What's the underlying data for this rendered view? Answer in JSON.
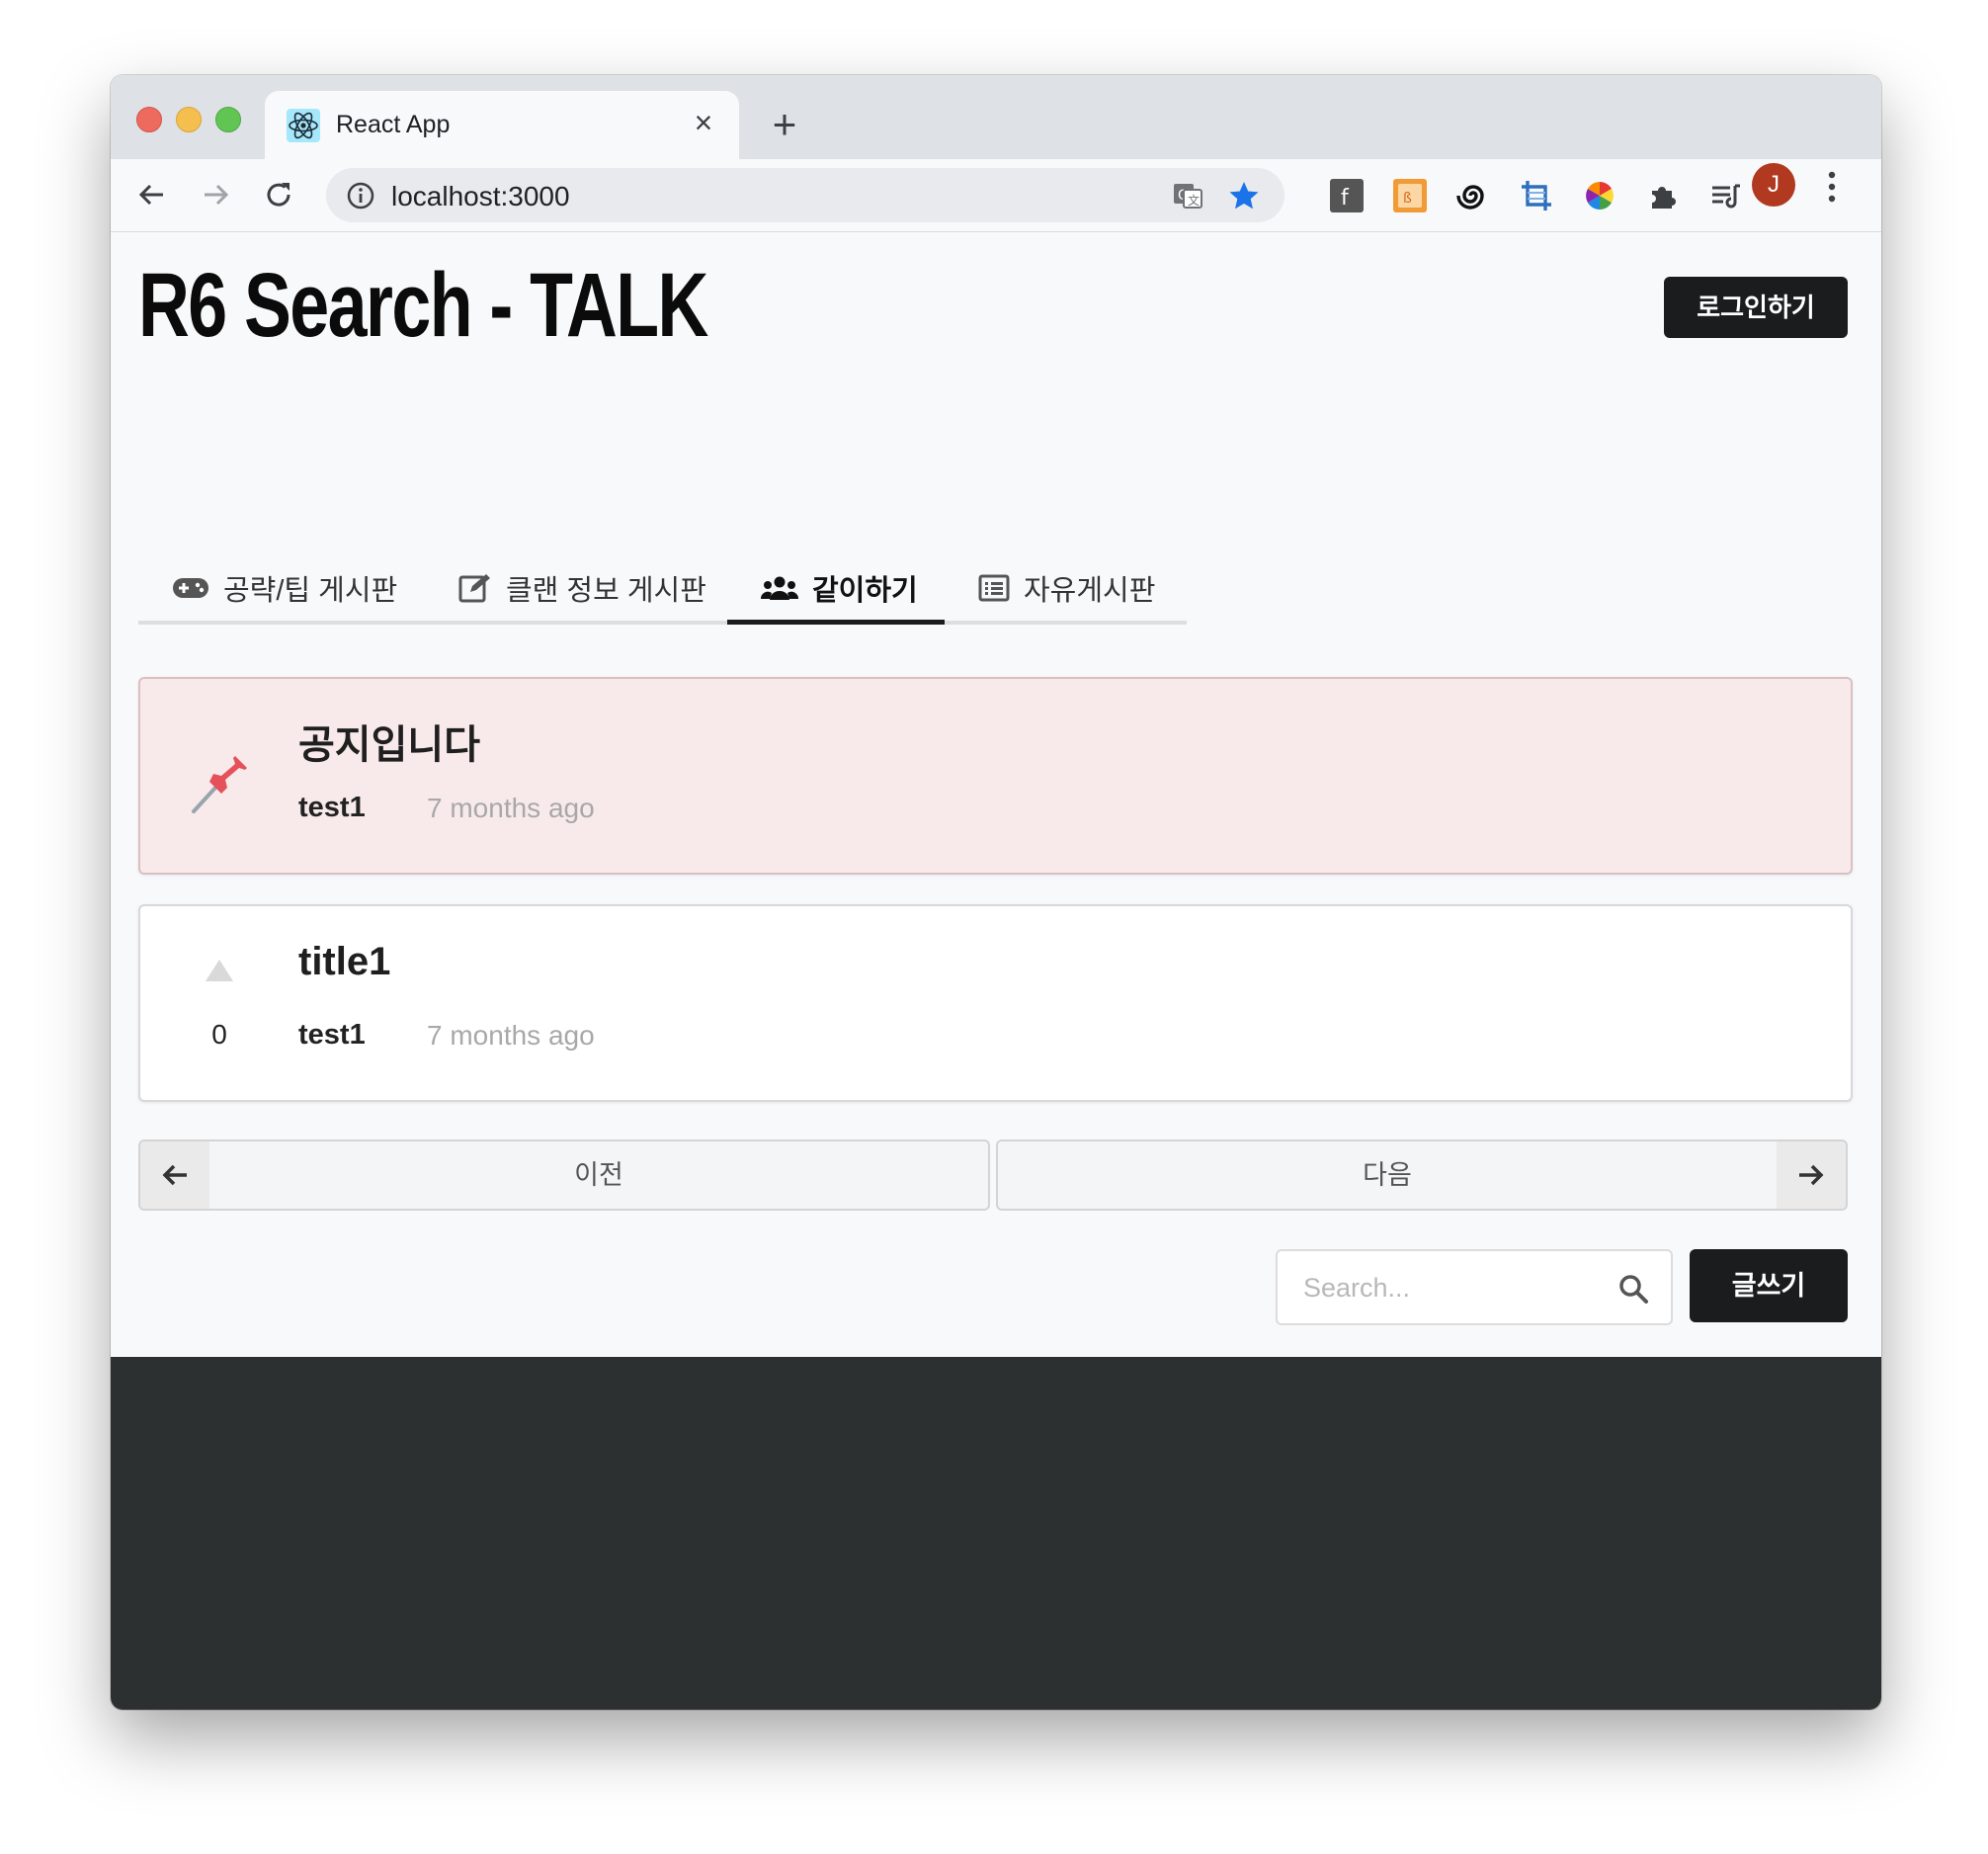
{
  "browser": {
    "tab_title": "React App",
    "url": "localhost:3000",
    "profile_initial": "J"
  },
  "site": {
    "title": "R6 Search - TALK",
    "login_label": "로그인하기"
  },
  "menu": {
    "items": [
      {
        "label": "공략/팁 게시판",
        "icon": "gamepad-icon"
      },
      {
        "label": "클랜 정보 게시판",
        "icon": "edit-icon"
      },
      {
        "label": "같이하기",
        "icon": "users-icon",
        "active": true
      },
      {
        "label": "자유게시판",
        "icon": "list-icon"
      }
    ]
  },
  "posts": {
    "notice": {
      "title": "공지입니다",
      "author": "test1",
      "time": "7 months ago"
    },
    "items": [
      {
        "title": "title1",
        "author": "test1",
        "time": "7 months ago",
        "votes": "0"
      }
    ]
  },
  "pagination": {
    "prev_label": "이전",
    "next_label": "다음"
  },
  "search": {
    "placeholder": "Search..."
  },
  "write_label": "글쓰기",
  "colors": {
    "notice_bg": "#f8eaeb",
    "button_dark": "#1b1c1d",
    "footer_bg": "#2d3031",
    "profile_avatar": "#b0391f"
  }
}
